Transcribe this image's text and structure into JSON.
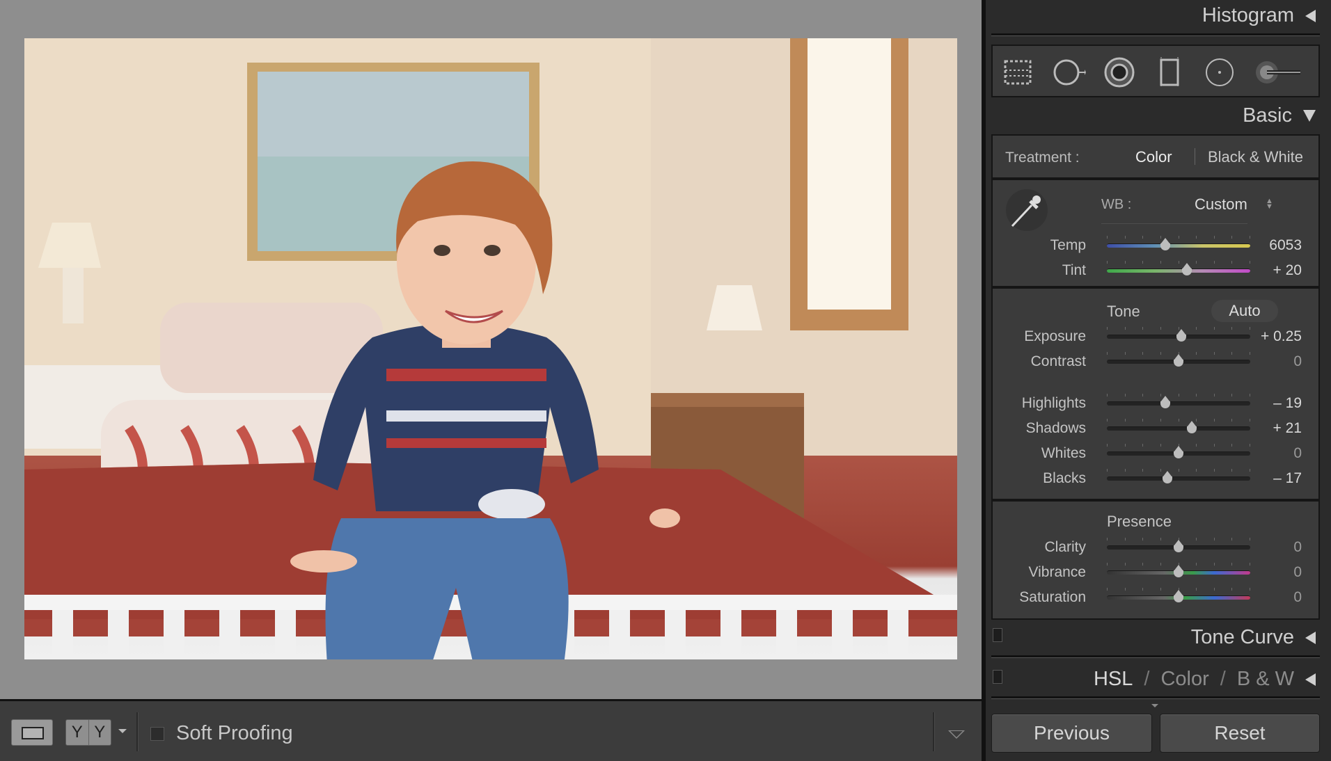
{
  "panel": {
    "histogram_label": "Histogram",
    "tools": [
      "crop-overlay-icon",
      "spot-removal-icon",
      "red-eye-icon",
      "graduated-filter-icon",
      "radial-filter-icon",
      "adjustment-brush-icon"
    ],
    "basic_label": "Basic",
    "treatment": {
      "label": "Treatment :",
      "color": "Color",
      "bw": "Black & White"
    },
    "wb": {
      "label": "WB :",
      "value": "Custom"
    },
    "temp": {
      "label": "Temp",
      "value": "6053",
      "pos": 0.41
    },
    "tint": {
      "label": "Tint",
      "value": "+ 20",
      "pos": 0.56
    },
    "tone": {
      "title": "Tone",
      "auto": "Auto"
    },
    "exposure": {
      "label": "Exposure",
      "value": "+ 0.25",
      "pos": 0.52
    },
    "contrast": {
      "label": "Contrast",
      "value": "0",
      "pos": 0.5
    },
    "highlights": {
      "label": "Highlights",
      "value": "– 19",
      "pos": 0.41
    },
    "shadows": {
      "label": "Shadows",
      "value": "+ 21",
      "pos": 0.59
    },
    "whites": {
      "label": "Whites",
      "value": "0",
      "pos": 0.5
    },
    "blacks": {
      "label": "Blacks",
      "value": "– 17",
      "pos": 0.42
    },
    "presence": {
      "title": "Presence"
    },
    "clarity": {
      "label": "Clarity",
      "value": "0",
      "pos": 0.5
    },
    "vibrance": {
      "label": "Vibrance",
      "value": "0",
      "pos": 0.5
    },
    "saturation": {
      "label": "Saturation",
      "value": "0",
      "pos": 0.5
    },
    "tone_curve_label": "Tone Curve",
    "hsl": {
      "hsl": "HSL",
      "sep1": "/",
      "color": "Color",
      "sep2": "/",
      "bw": "B & W"
    },
    "previous_label": "Previous",
    "reset_label": "Reset"
  },
  "toolbar": {
    "yy_left": "Y",
    "yy_right": "Y",
    "soft_proofing_label": "Soft Proofing",
    "soft_proofing_checked": false
  },
  "colors": {
    "panel_bg": "#2b2b2b",
    "section_bg": "#3b3b3b",
    "view_bg": "#8e8e8e"
  }
}
